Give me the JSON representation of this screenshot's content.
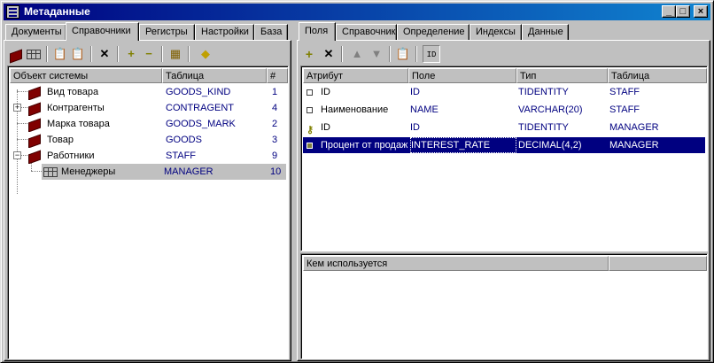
{
  "window": {
    "title": "Метаданные"
  },
  "left": {
    "tabs": [
      "Документы",
      "Справочники",
      "Регистры",
      "Настройки",
      "База"
    ],
    "active_tab": 1,
    "columns": [
      "Объект системы",
      "Таблица",
      "#"
    ],
    "rows": [
      {
        "name": "Вид товара",
        "table": "GOODS_KIND",
        "num": "1"
      },
      {
        "name": "Контрагенты",
        "table": "CONTRAGENT",
        "num": "4"
      },
      {
        "name": "Марка товара",
        "table": "GOODS_MARK",
        "num": "2"
      },
      {
        "name": "Товар",
        "table": "GOODS",
        "num": "3"
      },
      {
        "name": "Работники",
        "table": "STAFF",
        "num": "9"
      },
      {
        "name": "Менеджеры",
        "table": "MANAGER",
        "num": "10"
      }
    ]
  },
  "right": {
    "tabs": [
      "Поля",
      "Справочник",
      "Определение",
      "Индексы",
      "Данные"
    ],
    "active_tab": 0,
    "toolbar_id_label": "ID",
    "columns": [
      "Атрибут",
      "Поле",
      "Тип",
      "Таблица"
    ],
    "rows": [
      {
        "attr": "ID",
        "field": "ID",
        "type": "TIDENTITY",
        "table": "STAFF"
      },
      {
        "attr": "Наименование",
        "field": "NAME",
        "type": "VARCHAR(20)",
        "table": "STAFF"
      },
      {
        "attr": "ID",
        "field": "ID",
        "type": "TIDENTITY",
        "table": "MANAGER"
      },
      {
        "attr": "Процент от продаж",
        "field": "INTEREST_RATE",
        "type": "DECIMAL(4,2)",
        "table": "MANAGER"
      }
    ],
    "usage_header": "Кем используется"
  },
  "colors": {
    "title_start": "#000080",
    "title_end": "#1084d0",
    "selection": "#000080",
    "value_text": "#000080"
  }
}
